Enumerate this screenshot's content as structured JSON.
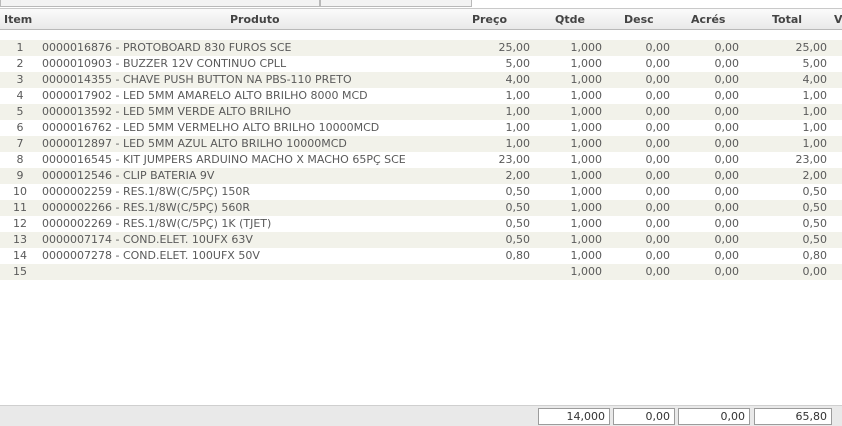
{
  "columns": {
    "item": "Item",
    "produto": "Produto",
    "preco": "Preço",
    "qtde": "Qtde",
    "desc": "Desc",
    "acres": "Acrés",
    "total": "Total",
    "extra": "V"
  },
  "rows": [
    {
      "item": "1",
      "produto": "0000016876 - PROTOBOARD  830 FUROS SCE",
      "preco": "25,00",
      "qtde": "1,000",
      "desc": "0,00",
      "acres": "0,00",
      "total": "25,00"
    },
    {
      "item": "2",
      "produto": "0000010903 - BUZZER 12V CONTINUO CPLL",
      "preco": "5,00",
      "qtde": "1,000",
      "desc": "0,00",
      "acres": "0,00",
      "total": "5,00"
    },
    {
      "item": "3",
      "produto": "0000014355 - CHAVE PUSH BUTTON NA PBS-110 PRETO",
      "preco": "4,00",
      "qtde": "1,000",
      "desc": "0,00",
      "acres": "0,00",
      "total": "4,00"
    },
    {
      "item": "4",
      "produto": "0000017902 - LED  5MM AMARELO ALTO BRILHO 8000 MCD",
      "preco": "1,00",
      "qtde": "1,000",
      "desc": "0,00",
      "acres": "0,00",
      "total": "1,00"
    },
    {
      "item": "5",
      "produto": "0000013592 - LED  5MM VERDE ALTO BRILHO",
      "preco": "1,00",
      "qtde": "1,000",
      "desc": "0,00",
      "acres": "0,00",
      "total": "1,00"
    },
    {
      "item": "6",
      "produto": "0000016762 - LED  5MM VERMELHO ALTO BRILHO 10000MCD",
      "preco": "1,00",
      "qtde": "1,000",
      "desc": "0,00",
      "acres": "0,00",
      "total": "1,00"
    },
    {
      "item": "7",
      "produto": "0000012897 - LED  5MM AZUL ALTO BRILHO 10000MCD",
      "preco": "1,00",
      "qtde": "1,000",
      "desc": "0,00",
      "acres": "0,00",
      "total": "1,00"
    },
    {
      "item": "8",
      "produto": "0000016545 - KIT JUMPERS ARDUINO MACHO X MACHO 65PÇ SCE",
      "preco": "23,00",
      "qtde": "1,000",
      "desc": "0,00",
      "acres": "0,00",
      "total": "23,00"
    },
    {
      "item": "9",
      "produto": "0000012546 - CLIP BATERIA 9V",
      "preco": "2,00",
      "qtde": "1,000",
      "desc": "0,00",
      "acres": "0,00",
      "total": "2,00"
    },
    {
      "item": "10",
      "produto": "0000002259 - RES.1/8W(C/5PÇ)          150R",
      "preco": "0,50",
      "qtde": "1,000",
      "desc": "0,00",
      "acres": "0,00",
      "total": "0,50"
    },
    {
      "item": "11",
      "produto": "0000002266 - RES.1/8W(C/5PÇ)          560R",
      "preco": "0,50",
      "qtde": "1,000",
      "desc": "0,00",
      "acres": "0,00",
      "total": "0,50"
    },
    {
      "item": "12",
      "produto": "0000002269 - RES.1/8W(C/5PÇ)          1K (TJET)",
      "preco": "0,50",
      "qtde": "1,000",
      "desc": "0,00",
      "acres": "0,00",
      "total": "0,50"
    },
    {
      "item": "13",
      "produto": "0000007174 - COND.ELET.    10UFX 63V",
      "preco": "0,50",
      "qtde": "1,000",
      "desc": "0,00",
      "acres": "0,00",
      "total": "0,50"
    },
    {
      "item": "14",
      "produto": "0000007278 - COND.ELET.  100UFX 50V",
      "preco": "0,80",
      "qtde": "1,000",
      "desc": "0,00",
      "acres": "0,00",
      "total": "0,80"
    },
    {
      "item": "15",
      "produto": "",
      "preco": "",
      "qtde": "1,000",
      "desc": "0,00",
      "acres": "0,00",
      "total": "0,00"
    }
  ],
  "totals": {
    "qtde": "14,000",
    "desc": "0,00",
    "acres": "0,00",
    "total": "65,80"
  }
}
